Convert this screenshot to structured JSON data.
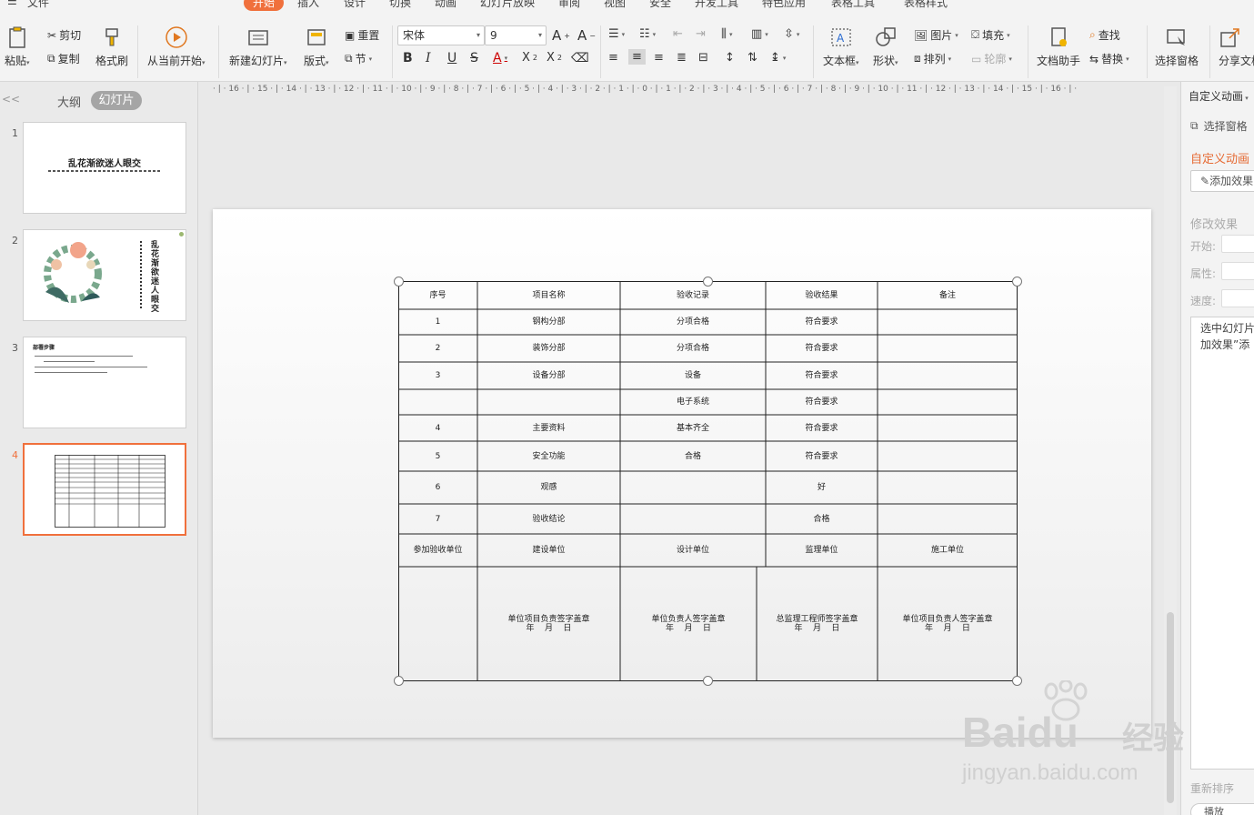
{
  "menu": {
    "items": [
      {
        "label": "文件"
      },
      {
        "label": "开始",
        "active": true
      },
      {
        "label": "插入"
      },
      {
        "label": "设计"
      },
      {
        "label": "切换"
      },
      {
        "label": "动画"
      },
      {
        "label": "幻灯片放映"
      },
      {
        "label": "审阅"
      },
      {
        "label": "视图"
      },
      {
        "label": "安全"
      },
      {
        "label": "开发工具"
      },
      {
        "label": "特色应用"
      },
      {
        "label": "表格工具"
      },
      {
        "label": "表格样式"
      }
    ]
  },
  "ribbon": {
    "paste": "粘贴",
    "cut": "剪切",
    "copy": "复制",
    "format_painter": "格式刷",
    "from_current": "从当前开始",
    "new_slide": "新建幻灯片",
    "layout": "版式",
    "reset": "重置",
    "section": "节",
    "font_name": "宋体",
    "font_size": "9",
    "textbox": "文本框",
    "shape": "形状",
    "picture": "图片",
    "fill": "填充",
    "arrange": "排列",
    "outline": "轮廓",
    "doc_assistant": "文档助手",
    "find": "查找",
    "replace": "替换",
    "selection_pane": "选择窗格",
    "share": "分享文档"
  },
  "left_panel": {
    "tab_outline": "大纲",
    "tab_slides": "幻灯片",
    "collapse": "<<",
    "slides": [
      {
        "num": "1",
        "title": "乱花渐欲迷人眼交"
      },
      {
        "num": "2",
        "title": "乱花渐欲迷人眼交"
      },
      {
        "num": "3",
        "title": "部署步骤"
      },
      {
        "num": "4",
        "active": true
      }
    ]
  },
  "ruler": {
    "text": "· | · 16 · | · 15 · | · 14 · | · 13 · | · 12 · | · 11 · | · 10 · | · 9 · | · 8 · | · 7 · | · 6 · | · 5 · | · 4 · | · 3 · | · 2 · | · 1 · | · 0 · | · 1 · | · 2 · | · 3 · | · 4 · | · 5 · | · 6 · | · 7 · | · 8 · | · 9 · | · 10 · | · 11 · | · 12 · | · 13 · | · 14 · | · 15 · | · 16 · | ·"
  },
  "table": {
    "header": [
      "序号",
      "项目名称",
      "验收记录",
      "验收结果",
      "备注"
    ],
    "rows": [
      [
        "1",
        "钢构分部",
        "分项合格",
        "符合要求",
        ""
      ],
      [
        "2",
        "装饰分部",
        "分项合格",
        "符合要求",
        ""
      ],
      [
        "3",
        "设备分部",
        "设备",
        "符合要求",
        ""
      ],
      [
        "",
        "",
        "电子系统",
        "符合要求",
        ""
      ],
      [
        "4",
        "主要资料",
        "基本齐全",
        "符合要求",
        ""
      ],
      [
        "5",
        "安全功能",
        "合格",
        "符合要求",
        ""
      ],
      [
        "6",
        "观感",
        "",
        "好",
        ""
      ],
      [
        "7",
        "验收结论",
        "",
        "合格",
        ""
      ],
      [
        "参加验收单位",
        "建设单位",
        "设计单位",
        "监理单位",
        "施工单位"
      ]
    ],
    "sign": [
      {
        "line1": "单位项目负责签字盖章",
        "line2": "年    月    日"
      },
      {
        "line1": "单位负责人签字盖章",
        "line2": "年    月    日"
      },
      {
        "line1": "总监理工程师签字盖章",
        "line2": "年    月    日"
      },
      {
        "line1": "单位项目负责人签字盖章",
        "line2": "年    月    日"
      }
    ]
  },
  "right_pane": {
    "title": "自定义动画",
    "selection_pane": "选择窗格",
    "heading": "自定义动画",
    "add_effect": "添加效果",
    "modify": "修改效果",
    "start": "开始:",
    "property": "属性:",
    "speed": "速度:",
    "hint_line1": "选中幻灯片",
    "hint_line2": "加效果”添",
    "reorder": "重新排序",
    "play": "播放"
  },
  "watermark": {
    "brand": "Baidu",
    "brand_cn": "经验",
    "url": "jingyan.baidu.com"
  }
}
